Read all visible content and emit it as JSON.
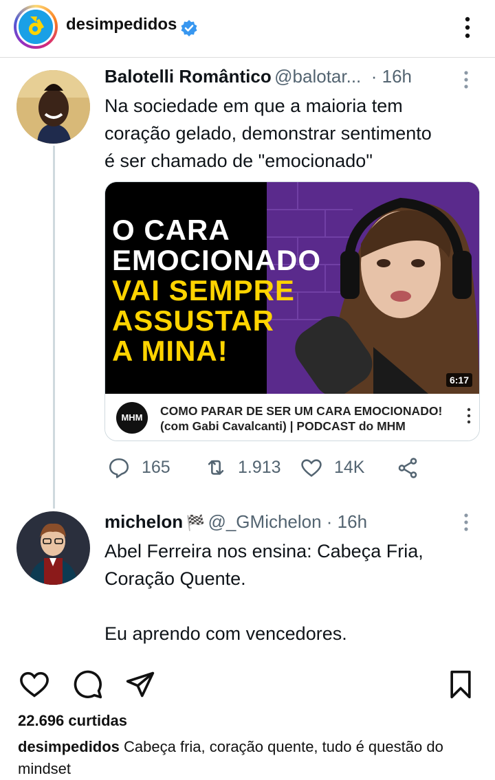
{
  "post": {
    "username": "desimpedidos",
    "likes": "22.696 curtidas",
    "caption_user": "desimpedidos",
    "caption_text": " Cabeça fria, coração quente, tudo é questão do mindset"
  },
  "tweet1": {
    "name": "Balotelli Romântico",
    "handle": "@balotar...",
    "time": "· 16h",
    "text": "Na sociedade em que a maioria tem\ncoração gelado, demonstrar sentimento\né ser chamado de \"emocionado\"",
    "thumbnail_lines": [
      "O CARA",
      "EMOCIONADO",
      "VAI SEMPRE",
      "ASSUSTAR",
      "A MINA!"
    ],
    "duration": "6:17",
    "channel_logo_text": "MHM",
    "video_title_1": "COMO PARAR DE SER UM CARA EMOCIONADO!",
    "video_title_2": "(com Gabi Cavalcanti) | PODCAST do MHM",
    "replies": "165",
    "retweets": "1.913",
    "likes": "14K"
  },
  "tweet2": {
    "name": "michelon",
    "flag": "🏁",
    "handle": "@_GMichelon · 16h",
    "text": "Abel Ferreira nos ensina: Cabeça Fria,\nCoração Quente.\n\nEu aprendo com vencedores."
  },
  "colors": {
    "verified": "#3897f0",
    "thumbnail_bg": "#4b1f7a",
    "thumbnail_yellow": "#ffd400",
    "muted": "#536471"
  }
}
